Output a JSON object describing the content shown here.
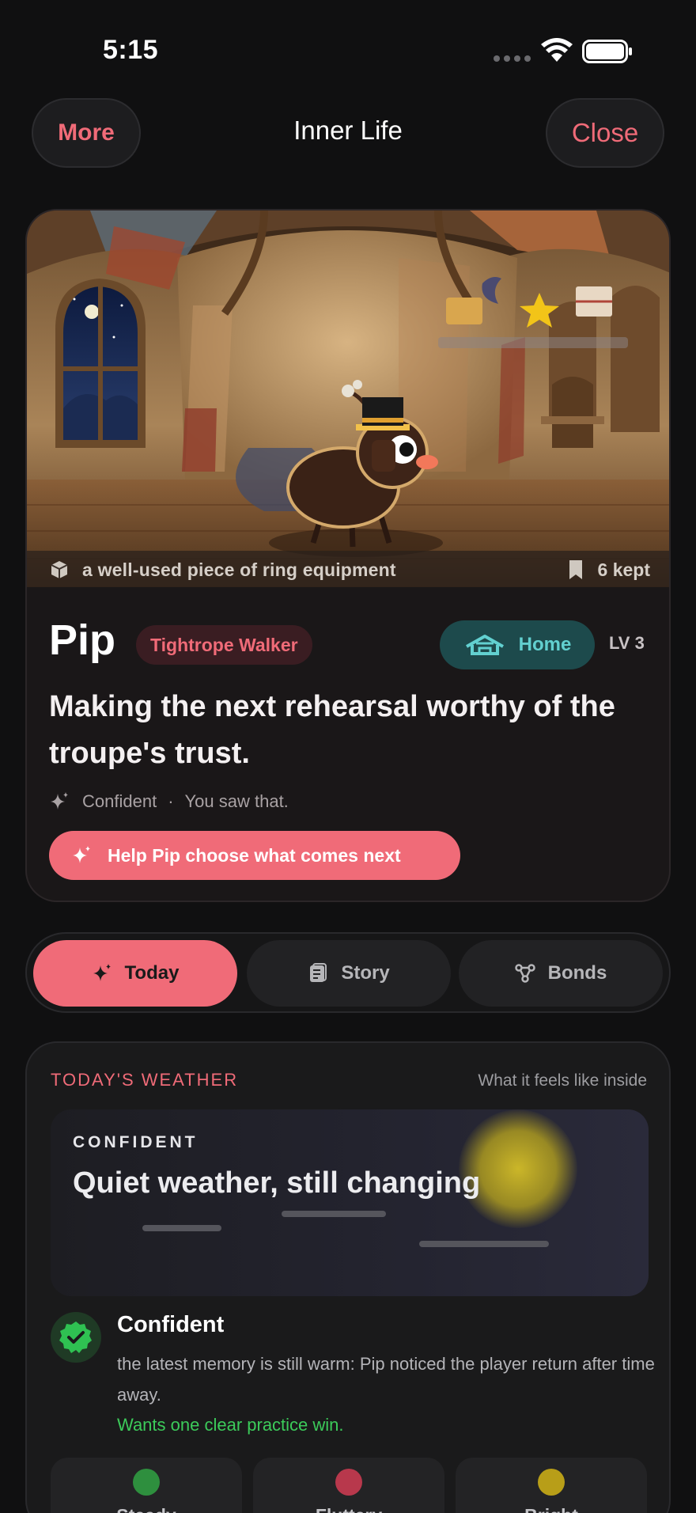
{
  "status_bar": {
    "time": "5:15"
  },
  "header": {
    "more_label": "More",
    "title": "Inner Life",
    "close_label": "Close"
  },
  "hero": {
    "caption": "a well-used piece of ring equipment",
    "kept": "6 kept",
    "name": "Pip",
    "role": "Tightrope Walker",
    "location": "Home",
    "level": "LV 3",
    "goal": "Making the next rehearsal worthy of the troupe's trust.",
    "mood": "Confident",
    "mood_separator": "·",
    "mood_note": "You saw that.",
    "cta_label": "Help Pip choose what comes next"
  },
  "tabs": [
    {
      "label": "Today",
      "icon": "sparkle-icon",
      "active": true
    },
    {
      "label": "Story",
      "icon": "journal-icon",
      "active": false
    },
    {
      "label": "Bonds",
      "icon": "bonds-icon",
      "active": false
    }
  ],
  "weather": {
    "heading": "TODAY'S WEATHER",
    "subheading": "What it feels like inside",
    "tag": "CONFIDENT",
    "title": "Quiet weather, still changing",
    "state_title": "Confident",
    "state_description": "the latest memory is still warm: Pip noticed the player return after time away.",
    "state_want": "Wants one clear practice win.",
    "traits": [
      {
        "label": "Steady",
        "color": "#2e8f3e"
      },
      {
        "label": "Fluttery",
        "color": "#b8384c"
      },
      {
        "label": "Bright",
        "color": "#b89e18"
      }
    ]
  },
  "colors": {
    "accent": "#f06b78",
    "home_badge": "#62d0d0",
    "positive": "#3ccb5a",
    "background": "#101011"
  }
}
